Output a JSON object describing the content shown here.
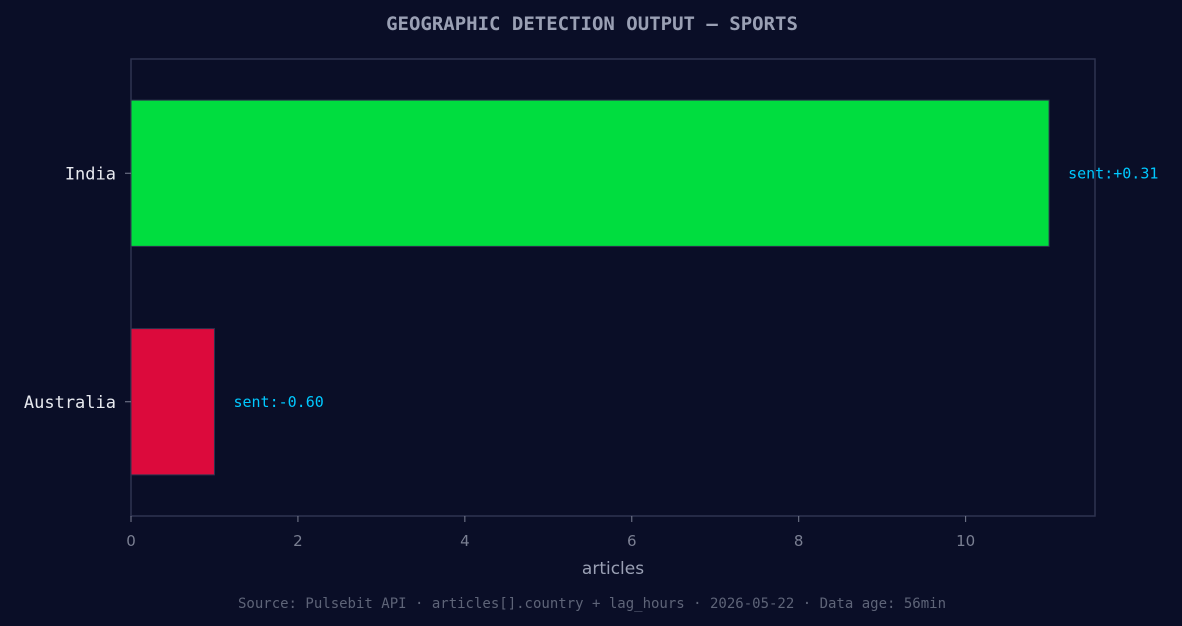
{
  "chart_data": {
    "type": "bar",
    "orientation": "horizontal",
    "title": "GEOGRAPHIC DETECTION OUTPUT — SPORTS",
    "xlabel": "articles",
    "ylabel": "",
    "xlim": [
      0,
      11.55
    ],
    "x_ticks": [
      0,
      2,
      4,
      6,
      8,
      10
    ],
    "categories": [
      "India",
      "Australia"
    ],
    "values": [
      11,
      1
    ],
    "annotations": [
      "sent:+0.31",
      "sent:-0.60"
    ],
    "colors": [
      "#00dd3f",
      "#dc0a3c"
    ],
    "grid": false,
    "legend": "none",
    "source": "Source: Pulsebit API · articles[].country + lag_hours · 2026-05-22 · Data age: 56min"
  },
  "colors": {
    "background": "#0a0e27",
    "axis": "#2e3350",
    "title": "#9aa0b4",
    "tick": "#7a7f92",
    "category_label": "#e8eaf0",
    "annotation": "#00c8ff"
  }
}
